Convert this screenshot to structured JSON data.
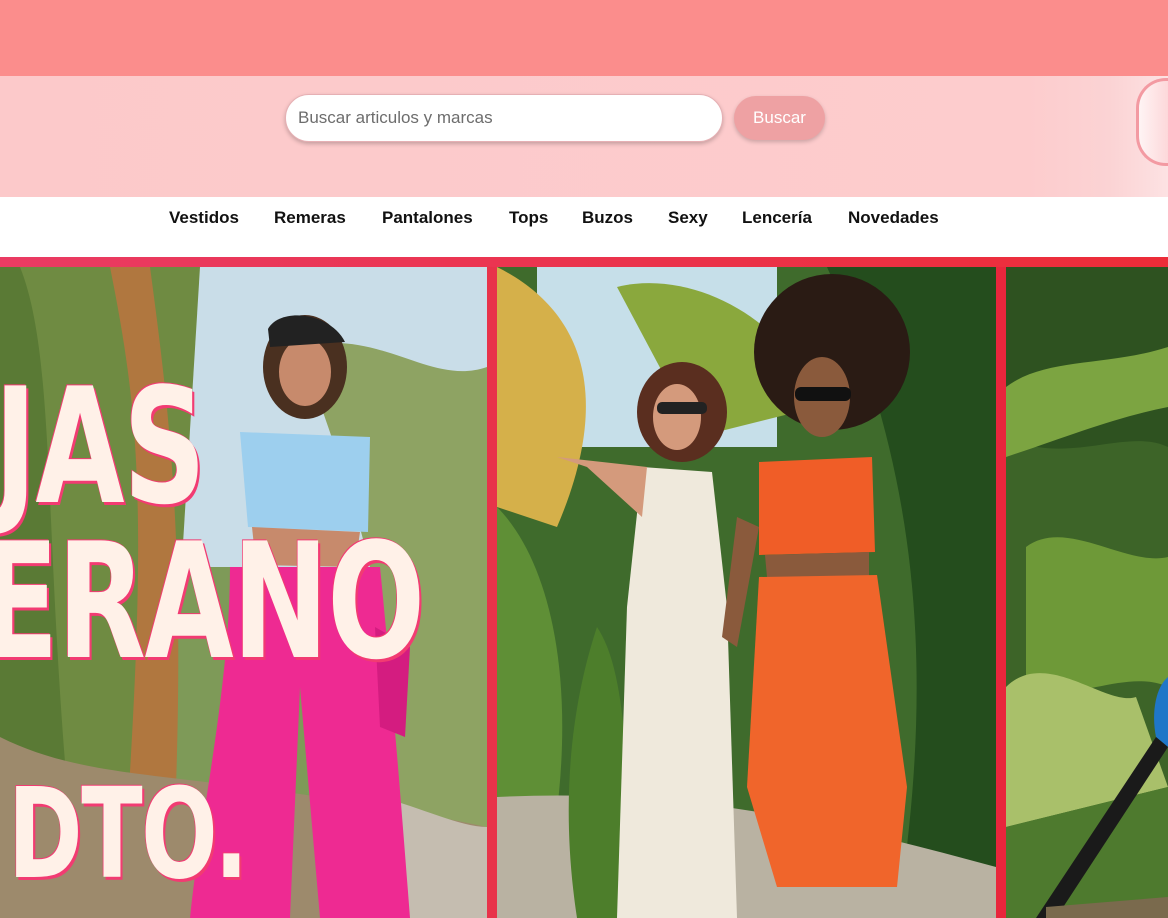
{
  "search": {
    "placeholder": "Buscar articulos y marcas",
    "button_label": "Buscar"
  },
  "nav": {
    "items": [
      {
        "label": "Vestidos"
      },
      {
        "label": "Remeras"
      },
      {
        "label": "Pantalones"
      },
      {
        "label": "Tops"
      },
      {
        "label": "Buzos"
      },
      {
        "label": "Sexy"
      },
      {
        "label": "Lencería"
      },
      {
        "label": "Novedades"
      }
    ]
  },
  "hero": {
    "promo_lines": [
      "JAS",
      "ERANO",
      "E DTO."
    ]
  },
  "colors": {
    "top_bar": "#fb8d8c",
    "search_bar": "#fdcbcc",
    "button": "#eea1a3",
    "accent_red": "#e8334a",
    "promo_outline": "#f23b72"
  }
}
